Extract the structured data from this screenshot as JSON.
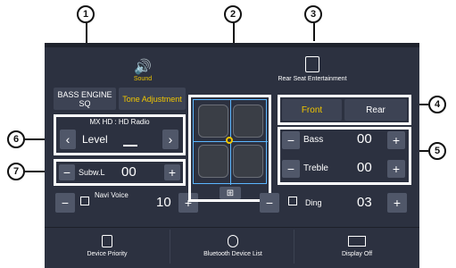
{
  "screen": {
    "top_tabs": {
      "sound": "Sound",
      "rear": "Rear Seat Entertainment"
    },
    "left": {
      "bass_engine": "BASS ENGINE SQ",
      "tone_adjust": "Tone Adjustment",
      "source": "MX HD : HD Radio",
      "level_label": "Level",
      "subw_label": "Subw.L",
      "subw_value": "00",
      "navi_label": "Navi Voice",
      "navi_value": "10"
    },
    "right": {
      "front": "Front",
      "rear": "Rear",
      "bass_label": "Bass",
      "bass_value": "00",
      "treble_label": "Treble",
      "treble_value": "00",
      "ding_label": "Ding",
      "ding_value": "03"
    },
    "bottom": {
      "device_priority": "Device Priority",
      "bt_device_list": "Bluetooth Device List",
      "display_off": "Display Off"
    }
  },
  "callouts": [
    "1",
    "2",
    "3",
    "4",
    "5",
    "6",
    "7"
  ]
}
